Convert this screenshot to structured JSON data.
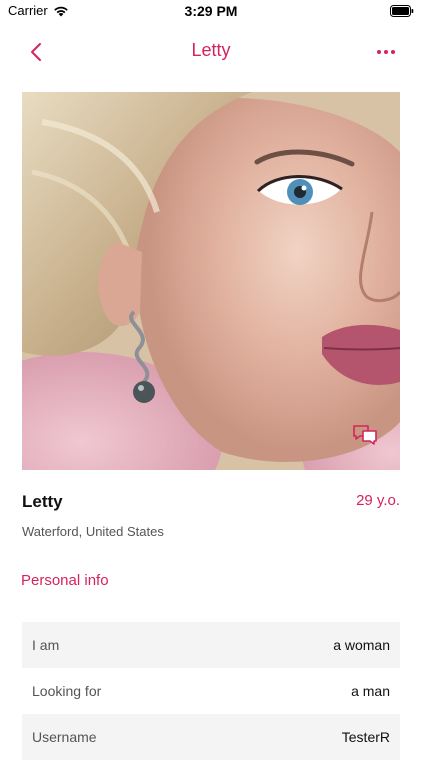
{
  "status_bar": {
    "carrier": "Carrier",
    "time": "3:29 PM",
    "icons": [
      "wifi-icon",
      "battery-icon"
    ]
  },
  "nav": {
    "title": "Letty",
    "back_icon": "chevron-left-icon",
    "more_icon": "more-dots-icon"
  },
  "profile": {
    "name": "Letty",
    "age": "29 y.o.",
    "location": "Waterford, United States",
    "photo_icon": "chat-bubbles-icon"
  },
  "personal_info": {
    "title": "Personal info",
    "rows": [
      {
        "label": "I am",
        "value": "a woman"
      },
      {
        "label": "Looking for",
        "value": "a man"
      },
      {
        "label": "Username",
        "value": "TesterR"
      }
    ]
  },
  "colors": {
    "accent": "#d3255b",
    "row_shade": "#f4f4f4",
    "secondary_text": "#555555"
  }
}
